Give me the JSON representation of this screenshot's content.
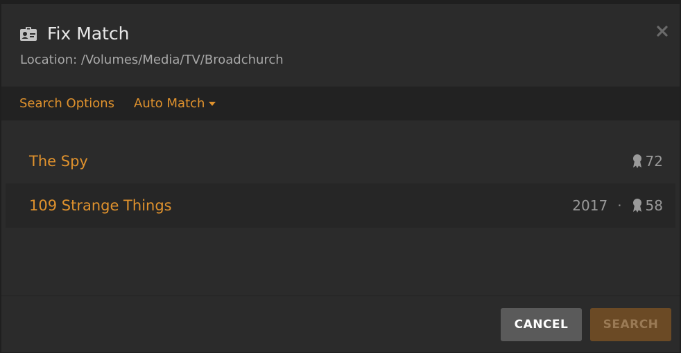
{
  "dialog": {
    "title": "Fix Match",
    "location": "Location: /Volumes/Media/TV/Broadchurch"
  },
  "toolbar": {
    "search_options_label": "Search Options",
    "auto_match_label": "Auto Match"
  },
  "results": [
    {
      "title": "The Spy",
      "year": "",
      "score": "72"
    },
    {
      "title": "109 Strange Things",
      "year": "2017",
      "separator": "·",
      "score": "58"
    }
  ],
  "footer": {
    "cancel_label": "CANCEL",
    "search_label": "SEARCH"
  },
  "colors": {
    "accent": "#e0922d",
    "background": "#2b2b2b",
    "toolbar": "#222222",
    "cancel_button": "#5a5a5a",
    "search_button_disabled": "#6b4a25"
  },
  "icons": {
    "title_icon": "id-card-icon",
    "close_icon": "close-icon",
    "score_icon": "award-ribbon-icon",
    "dropdown_icon": "caret-down-icon"
  }
}
